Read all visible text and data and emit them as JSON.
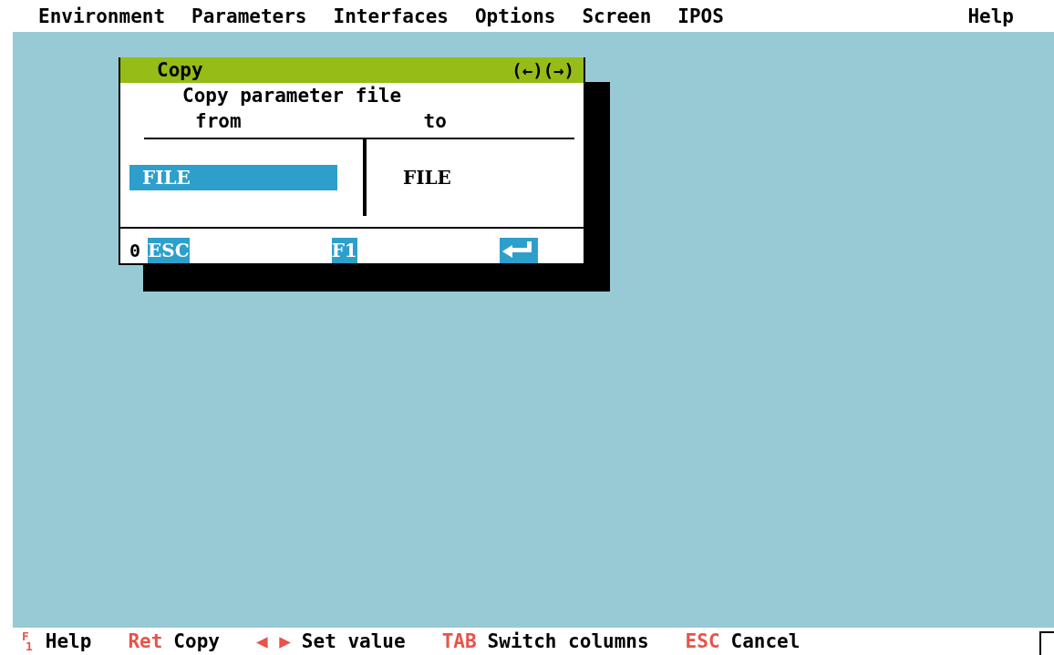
{
  "menu_bar": [
    {
      "label": "Environment"
    },
    {
      "label": "Parameters"
    },
    {
      "label": "Interfaces"
    },
    {
      "label": "Options"
    },
    {
      "label": "Screen"
    },
    {
      "label": "IPOS"
    },
    {
      "label": "Help"
    }
  ],
  "dialog": {
    "title": "Copy",
    "nav_left": "(←)",
    "nav_right": "(→)",
    "heading": "Copy parameter file",
    "from_label": "from",
    "to_label": "to",
    "from_value": "FILE",
    "from_selected": true,
    "to_value": "FILE",
    "footer_number": "0",
    "footer_keys": [
      {
        "kind": "text",
        "label": "ESC"
      },
      {
        "kind": "text",
        "label": "F1"
      },
      {
        "kind": "enter"
      }
    ]
  },
  "status_bar": [
    {
      "key": "F1",
      "kind": "stacked",
      "action": "Help"
    },
    {
      "key": "Ret",
      "kind": "text",
      "action": "Copy"
    },
    {
      "key": "◀ ▶",
      "kind": "text",
      "action": "Set value"
    },
    {
      "key": "TAB",
      "kind": "text",
      "action": "Switch columns"
    },
    {
      "key": "ESC",
      "kind": "text",
      "action": "Cancel"
    }
  ]
}
